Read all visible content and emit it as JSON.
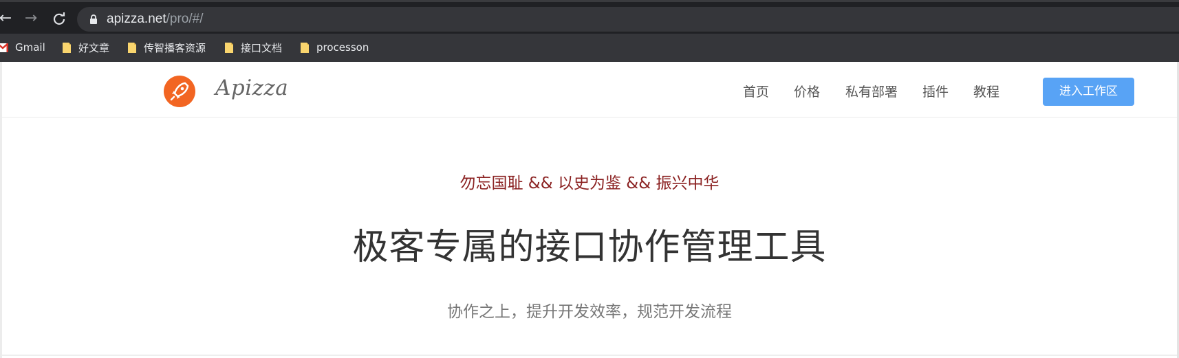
{
  "browser": {
    "url_host": "apizza.net",
    "url_path": "/pro/#/",
    "bookmarks": [
      {
        "label": "Gmail",
        "icon": "gmail-icon"
      },
      {
        "label": "好文章",
        "icon": "folder-icon"
      },
      {
        "label": "传智播客资源",
        "icon": "folder-icon"
      },
      {
        "label": "接口文档",
        "icon": "folder-icon"
      },
      {
        "label": "processon",
        "icon": "folder-icon"
      }
    ]
  },
  "site": {
    "logo_text": "Apizza",
    "brand_color": "#f26522",
    "nav": [
      {
        "label": "首页"
      },
      {
        "label": "价格"
      },
      {
        "label": "私有部署"
      },
      {
        "label": "插件"
      },
      {
        "label": "教程"
      }
    ],
    "workspace_button": "进入工作区",
    "accent_color": "#58a3f5"
  },
  "hero": {
    "slogan": "勿忘国耻 && 以史为鉴 && 振兴中华",
    "title": "极客专属的接口协作管理工具",
    "subtitle": "协作之上，提升开发效率，规范开发流程"
  }
}
